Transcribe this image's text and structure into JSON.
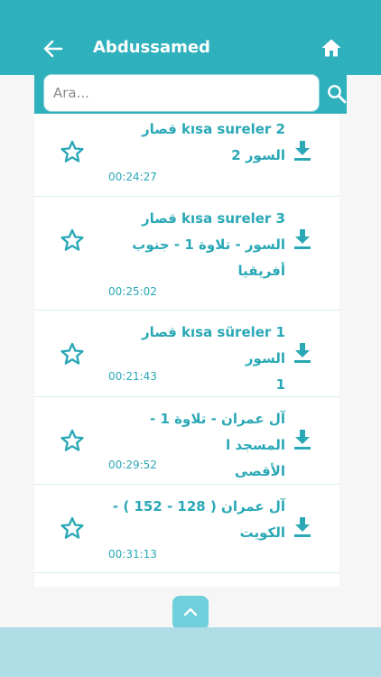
{
  "header": {
    "title": "Abdussamed"
  },
  "search": {
    "placeholder": "Ara..."
  },
  "items": [
    {
      "title_lines": [
        "kısa sureler 2 قصار",
        "السور 2"
      ],
      "duration": "00:24:27"
    },
    {
      "title_lines": [
        "kısa sureler 3 قصار",
        "السور - تلاوة 1 - جنوب",
        "أفريقيا"
      ],
      "duration": "00:25:02"
    },
    {
      "title_lines": [
        "kısa süreler 1 قصار السور",
        "1"
      ],
      "duration": "00:21:43"
    },
    {
      "title_lines": [
        "آل عمران - تلاوة 1 - المسجد ا",
        "الأقصى"
      ],
      "duration": "00:29:52"
    },
    {
      "title_lines": [
        "آل عمران ( 128 - 152 ) -",
        "الكويت"
      ],
      "duration": "00:31:13"
    }
  ],
  "colors": {
    "primary": "#2fb0bd",
    "accent": "#2aa8b6",
    "footer": "#aedde5",
    "scroll_button": "#6fd0dc"
  },
  "icons": {
    "back": "arrow-left-icon",
    "home": "home-icon",
    "search": "search-icon",
    "favorite": "star-outline-icon",
    "download": "download-icon",
    "scroll_top": "chevron-up-icon"
  }
}
